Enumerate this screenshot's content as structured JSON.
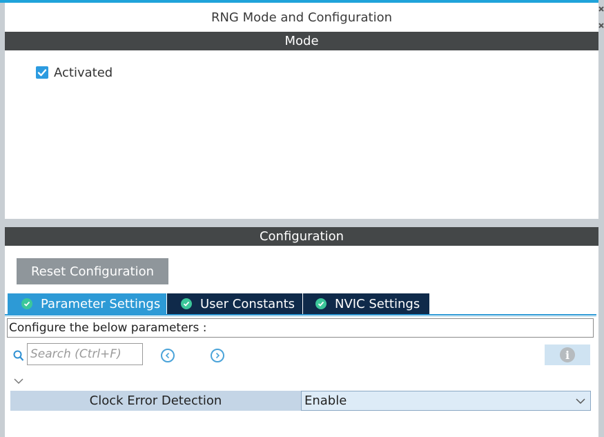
{
  "window": {
    "title": "RNG Mode and Configuration"
  },
  "mode": {
    "header": "Mode",
    "activated": {
      "label": "Activated",
      "checked": true
    }
  },
  "configuration": {
    "header": "Configuration",
    "reset_label": "Reset Configuration",
    "tabs": [
      {
        "label": "Parameter Settings",
        "active": true,
        "icon": "check-circle-icon"
      },
      {
        "label": "User Constants",
        "active": false,
        "icon": "check-circle-icon"
      },
      {
        "label": "NVIC Settings",
        "active": false,
        "icon": "check-circle-icon"
      }
    ],
    "instruction": "Configure the below parameters :",
    "search": {
      "placeholder": "Search (Ctrl+F)",
      "value": ""
    },
    "parameters": [
      {
        "name": "Clock Error Detection",
        "value": "Enable"
      }
    ]
  },
  "colors": {
    "accent": "#2d9ad6",
    "header_bar": "#444748",
    "tab_dark": "#0f2a4a",
    "check_green": "#3cc79a"
  }
}
